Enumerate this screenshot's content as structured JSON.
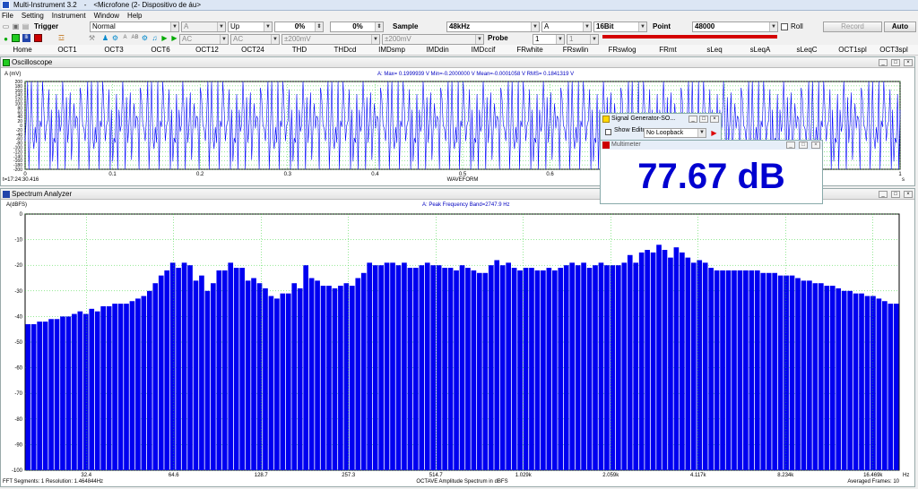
{
  "title": {
    "app": "Multi-Instrument 3.2",
    "sep": "-",
    "source": "<Microfone (2- Dispositivo de áu>"
  },
  "menu": [
    "File",
    "Setting",
    "Instrument",
    "Window",
    "Help"
  ],
  "toolbar1": {
    "trigger_label": "Trigger",
    "trigger_mode": "Normal",
    "trigger_channel": "A",
    "trigger_edge": "Up",
    "level1": "0%",
    "level2": "0%",
    "sample_label": "Sample",
    "sample_rate": "48kHz",
    "channel": "A",
    "bits": "16Bit",
    "point_label": "Point",
    "points": "48000",
    "roll_label": "Roll",
    "record_label": "Record",
    "auto_label": "Auto"
  },
  "toolbar2": {
    "coupling_a": "AC",
    "coupling_b": "AC",
    "range_a": "±200mV",
    "range_b": "±200mV",
    "probe_label": "Probe",
    "probe_a": "1",
    "probe_b": "1"
  },
  "tabs": [
    "Home",
    "OCT1",
    "OCT3",
    "OCT6",
    "OCT12",
    "OCT24",
    "THD",
    "THDcd",
    "IMDsmp",
    "IMDdin",
    "IMDccif",
    "FRwhite",
    "FRswlin",
    "FRswlog",
    "FRmt",
    "sLeq",
    "sLeqA",
    "sLeqC",
    "OCT1spl",
    "OCT3spl"
  ],
  "oscilloscope": {
    "title": "Oscilloscope",
    "ylabel": "A (mV)",
    "stats": "A: Max= 0.1999939 V  Min=-0.2000000 V  Mean=-0.0001058 V  RMS= 0.1841319 V",
    "yticks": [
      "200",
      "180",
      "160",
      "140",
      "120",
      "100",
      "80",
      "60",
      "40",
      "20",
      "0",
      "-20",
      "-40",
      "-60",
      "-80",
      "-100",
      "-120",
      "-140",
      "-160",
      "-180",
      "-200"
    ],
    "xticks": [
      "0",
      "0.1",
      "0.2",
      "0.3",
      "0.4",
      "0.5",
      "0.6",
      "0.7",
      "0.8",
      "0.9",
      "1"
    ],
    "xunit": "s",
    "xlabel": "WAVEFORM",
    "timestamp": "t=17:24:30.416"
  },
  "spectrum": {
    "title": "Spectrum Analyzer",
    "ylabel": "A(dBFS)",
    "peak": "A: Peak Frequency Band=2747.9 Hz",
    "xlabel": "OCTAVE Amplitude Spectrum in dBFS",
    "xunit": "Hz",
    "segments": "FFT Segments: 1",
    "resolution": "Resolution: 1.464844Hz",
    "averaged": "Averaged Frames: 10"
  },
  "signal_generator": {
    "title": "Signal Generator-SO...",
    "show_editor": "Show Editor",
    "loopback": "No Loopback"
  },
  "multimeter": {
    "title": "Multimeter",
    "value": "77.67 dB"
  },
  "colors": {
    "trace": "#0000ff",
    "grid": "#2bd12b",
    "bar": "#0000f0",
    "value": "#0000d0",
    "generator_bar": "#d40000"
  },
  "chart_data": [
    {
      "type": "line",
      "title": "WAVEFORM",
      "xlabel": "",
      "ylabel": "A (mV)",
      "xlim": [
        0,
        1
      ],
      "ylim": [
        -200,
        200
      ],
      "grid": true,
      "series": [
        {
          "values": [
            0.35,
            -0.6,
            0.9,
            -0.85,
            0.2,
            0.95,
            -0.3,
            -0.95,
            0.7,
            -0.1,
            0.85,
            -0.75,
            0.4,
            -0.95,
            0.6,
            0.1,
            -0.8,
            0.95,
            -0.45,
            0.3,
            -0.9,
            0.8,
            -0.2,
            0.5,
            -0.7,
            0.95,
            -0.95,
            0.15,
            0.75,
            -0.55,
            0.9,
            -0.35,
            -0.85,
            0.6,
            0.05,
            -0.65,
            0.95,
            -0.9,
            0.45,
            -0.25,
            0.85,
            -0.6,
            0.3,
            -0.95,
            0.7,
            -0.05,
            0.9,
            -0.8
          ]
        }
      ]
    },
    {
      "type": "bar",
      "title": "OCTAVE Amplitude Spectrum in dBFS",
      "xlabel": "Hz",
      "ylabel": "A(dBFS)",
      "ylim": [
        -100,
        0
      ],
      "yticks": [
        0,
        -10,
        -20,
        -30,
        -40,
        -50,
        -60,
        -70,
        -80,
        -90,
        -100
      ],
      "xticks": [
        "32.4",
        "64.6",
        "128.7",
        "257.3",
        "514.7",
        "1.029k",
        "2.059k",
        "4.117k",
        "8.234k",
        "16.469k"
      ],
      "grid": true,
      "values": [
        -43,
        -43,
        -42,
        -42,
        -41,
        -41,
        -40,
        -40,
        -39,
        -38,
        -39,
        -37,
        -38,
        -36,
        -36,
        -35,
        -35,
        -35,
        -34,
        -33,
        -32,
        -30,
        -27,
        -24,
        -22,
        -19,
        -21,
        -19,
        -20,
        -26,
        -24,
        -30,
        -27,
        -22,
        -22,
        -19,
        -21,
        -21,
        -26,
        -25,
        -27,
        -29,
        -32,
        -33,
        -31,
        -31,
        -27,
        -29,
        -20,
        -25,
        -26,
        -28,
        -28,
        -29,
        -28,
        -27,
        -28,
        -25,
        -23,
        -19,
        -20,
        -20,
        -19,
        -19,
        -20,
        -19,
        -21,
        -21,
        -20,
        -19,
        -20,
        -20,
        -21,
        -21,
        -22,
        -20,
        -21,
        -22,
        -23,
        -23,
        -20,
        -18,
        -20,
        -19,
        -21,
        -22,
        -21,
        -21,
        -22,
        -22,
        -21,
        -22,
        -21,
        -20,
        -19,
        -20,
        -19,
        -21,
        -20,
        -19,
        -20,
        -20,
        -20,
        -19,
        -16,
        -19,
        -15,
        -14,
        -15,
        -12,
        -14,
        -17,
        -13,
        -15,
        -17,
        -19,
        -18,
        -19,
        -21,
        -22,
        -22,
        -22,
        -22,
        -22,
        -22,
        -22,
        -22,
        -23,
        -23,
        -23,
        -24,
        -24,
        -24,
        -25,
        -26,
        -26,
        -27,
        -27,
        -28,
        -28,
        -29,
        -30,
        -30,
        -31,
        -31,
        -32,
        -32,
        -33,
        -34,
        -35,
        -35
      ]
    }
  ]
}
